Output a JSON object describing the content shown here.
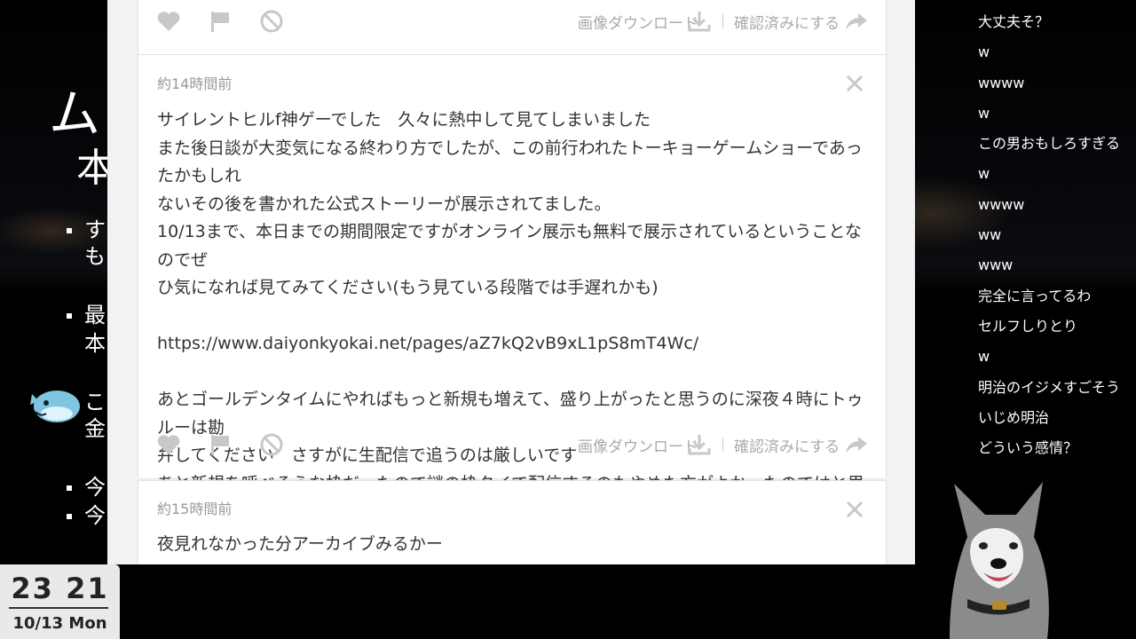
{
  "slide": {
    "title_fragment": "ム",
    "title_fragment2": "本",
    "bullets": [
      "す",
      "も",
      "最",
      "本",
      "こ",
      "金",
      "今",
      "今"
    ]
  },
  "clock": {
    "time": "23 21",
    "date": "10/13 Mon"
  },
  "comments": [
    {
      "time": "",
      "message": "",
      "actions": {
        "download": "画像ダウンロード",
        "confirm": "確認済みにする"
      }
    },
    {
      "time": "約14時間前",
      "message": "サイレントヒルf神ゲーでした　久々に熱中して見てしまいました\nまた後日談が大変気になる終わり方でしたが、この前行われたトーキョーゲームショーであったかもしれ\nないその後を書かれた公式ストーリーが展示されてました。\n10/13まで、本日までの期間限定ですがオンライン展示も無料で展示されているということなのでぜ\nひ気になれば見てみてください(もう見ている段階では手遅れかも)\n\nhttps://www.daiyonkyokai.net/pages/aZ7kQ2vB9xL1pS8mT4Wc/\n\nあとゴールデンタイムにやればもっと新規も増えて、盛り上がったと思うのに深夜４時にトゥルーは勘\n弁してください　さすがに生配信で追うのは厳しいです\nあと新規を呼べそうな枠だったので謎の枠タイで配信するのもやめた方がよかったのではと思ってます",
      "actions": {
        "download": "画像ダウンロード",
        "confirm": "確認済みにする"
      }
    },
    {
      "time": "約15時間前",
      "message": "夜見れなかった分アーカイブみるかー"
    }
  ],
  "chat": [
    "大丈夫そ？",
    "w",
    "wwww",
    "w",
    "この男おもしろすぎる",
    "w",
    "wwww",
    "ww",
    "www",
    "完全に言ってるわ",
    "セルフしりとり",
    "w",
    "明治のイジメすごそう",
    "いじめ明治",
    "どういう感情？"
  ]
}
